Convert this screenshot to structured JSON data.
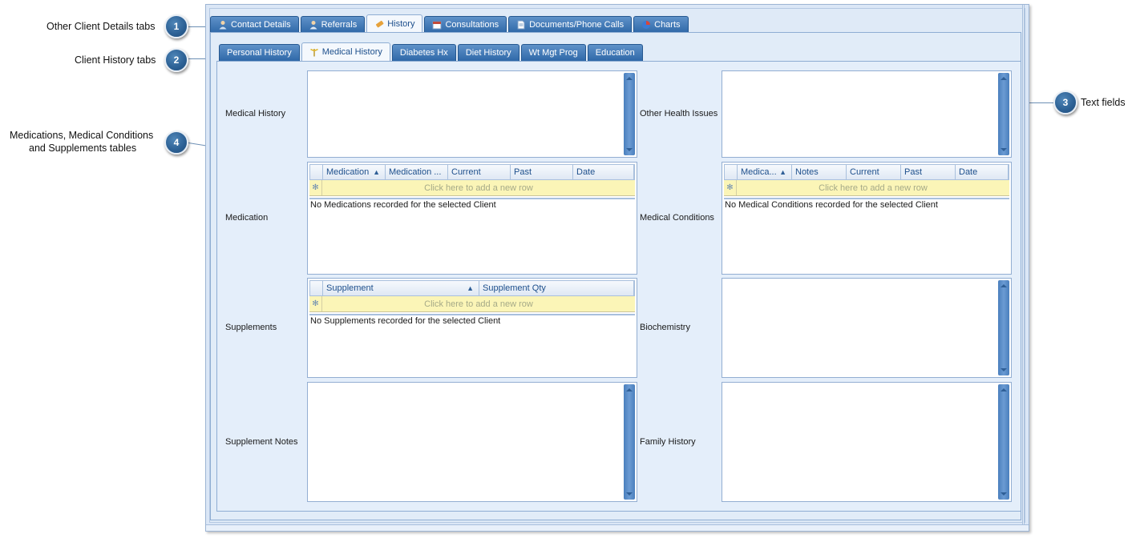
{
  "callouts": [
    {
      "number": "1",
      "label": "Other Client Details tabs"
    },
    {
      "number": "2",
      "label": "Client History tabs"
    },
    {
      "number": "3",
      "label": "Text fields"
    },
    {
      "number": "4",
      "label_line1": "Medications, Medical Conditions",
      "label_line2": "and Supplements tables"
    }
  ],
  "main_tabs": [
    {
      "label": "Contact Details",
      "icon": "contact-icon"
    },
    {
      "label": "Referrals",
      "icon": "referrals-icon"
    },
    {
      "label": "History",
      "icon": "history-icon",
      "active": true
    },
    {
      "label": "Consultations",
      "icon": "consultations-icon"
    },
    {
      "label": "Documents/Phone Calls",
      "icon": "document-icon"
    },
    {
      "label": "Charts",
      "icon": "chart-icon"
    }
  ],
  "history_tabs": [
    {
      "label": "Personal History"
    },
    {
      "label": "Medical History",
      "icon": "caduceus-icon",
      "active": true
    },
    {
      "label": "Diabetes Hx"
    },
    {
      "label": "Diet History"
    },
    {
      "label": "Wt Mgt Prog"
    },
    {
      "label": "Education"
    }
  ],
  "fields": {
    "medical_history": "Medical History",
    "other_health_issues": "Other Health Issues",
    "medication": "Medication",
    "medical_conditions": "Medical Conditions",
    "supplements": "Supplements",
    "biochemistry": "Biochemistry",
    "supplement_notes": "Supplement Notes",
    "family_history": "Family History"
  },
  "medication_grid": {
    "columns": [
      "Medication",
      "Medication ...",
      "Current",
      "Past",
      "Date"
    ],
    "new_row": "Click here to add a new row",
    "empty": "No Medications recorded for the selected Client"
  },
  "conditions_grid": {
    "columns": [
      "Medica...",
      "Notes",
      "Current",
      "Past",
      "Date"
    ],
    "new_row": "Click here to add a new row",
    "empty": "No Medical Conditions recorded for the selected Client"
  },
  "supplements_grid": {
    "columns": [
      "Supplement",
      "Supplement Qty"
    ],
    "new_row": "Click here to add a new row",
    "empty": "No Supplements recorded for the selected Client"
  },
  "colors": {
    "accent": "#2f68a8",
    "callout": "#2b5f93",
    "new_row": "#fbf5b7",
    "scrollbar": "#4a7fbd"
  }
}
